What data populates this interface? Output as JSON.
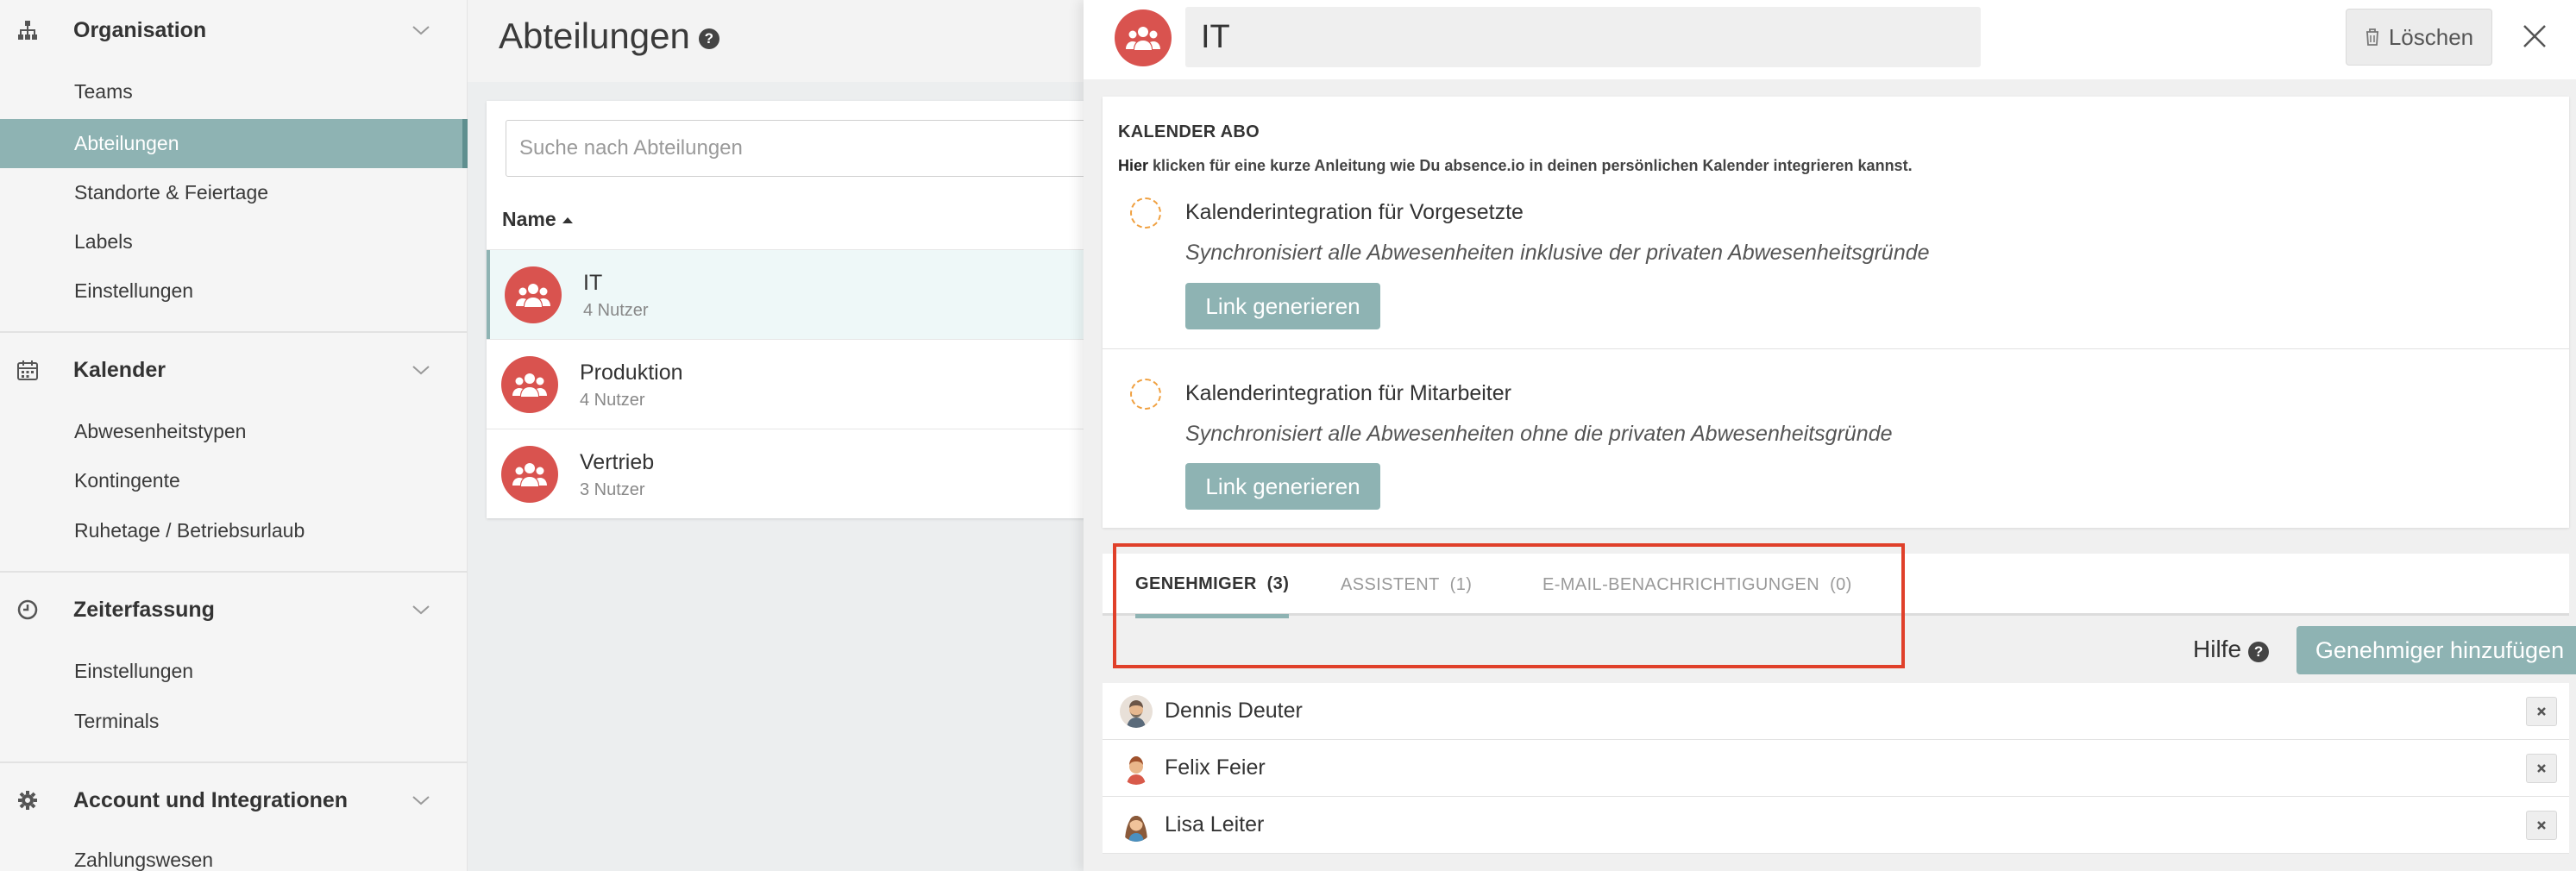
{
  "sidebar": {
    "sections": [
      {
        "title": "Organisation",
        "icon": "sitemap-icon",
        "items": [
          "Teams",
          "Abteilungen",
          "Standorte & Feiertage",
          "Labels",
          "Einstellungen"
        ]
      },
      {
        "title": "Kalender",
        "icon": "calendar-icon",
        "items": [
          "Abwesenheitstypen",
          "Kontingente",
          "Ruhetage / Betriebsurlaub"
        ]
      },
      {
        "title": "Zeiterfassung",
        "icon": "clock-icon",
        "items": [
          "Einstellungen",
          "Terminals"
        ]
      },
      {
        "title": "Account und Integrationen",
        "icon": "gear-icon",
        "items": [
          "Zahlungswesen"
        ]
      }
    ],
    "active_item": "Abteilungen"
  },
  "list": {
    "page_title": "Abteilungen",
    "search_placeholder": "Suche nach Abteilungen",
    "column_name": "Name",
    "rows": [
      {
        "name": "IT",
        "sub": "4 Nutzer"
      },
      {
        "name": "Produktion",
        "sub": "4 Nutzer"
      },
      {
        "name": "Vertrieb",
        "sub": "3 Nutzer"
      }
    ]
  },
  "detail": {
    "name_value": "IT",
    "delete_label": "Löschen",
    "calendar": {
      "title": "KALENDER ABO",
      "hint_bold": "Hier",
      "hint_rest": " klicken für eine kurze Anleitung wie Du absence.io in deinen persönlichen Kalender integrieren kannst.",
      "items": [
        {
          "title": "Kalenderintegration für Vorgesetzte",
          "desc": "Synchronisiert alle Abwesenheiten inklusive der privaten Abwesenheitsgründe",
          "button": "Link generieren"
        },
        {
          "title": "Kalenderintegration für Mitarbeiter",
          "desc": "Synchronisiert alle Abwesenheiten ohne die privaten Abwesenheitsgründe",
          "button": "Link generieren"
        }
      ]
    },
    "tabs": [
      {
        "label": "GENEHMIGER",
        "count": "(3)"
      },
      {
        "label": "ASSISTENT",
        "count": "(1)"
      },
      {
        "label": "E-MAIL-BENACHRICHTIGUNGEN",
        "count": "(0)"
      }
    ],
    "help_label": "Hilfe",
    "add_approver_label": "Genehmiger hinzufügen",
    "approvers": [
      {
        "name": "Dennis Deuter"
      },
      {
        "name": "Felix Feier"
      },
      {
        "name": "Lisa Leiter"
      }
    ]
  },
  "colors": {
    "accent": "#8eb3b3",
    "avatar_red": "#d9534f",
    "highlight": "#e0402a"
  }
}
